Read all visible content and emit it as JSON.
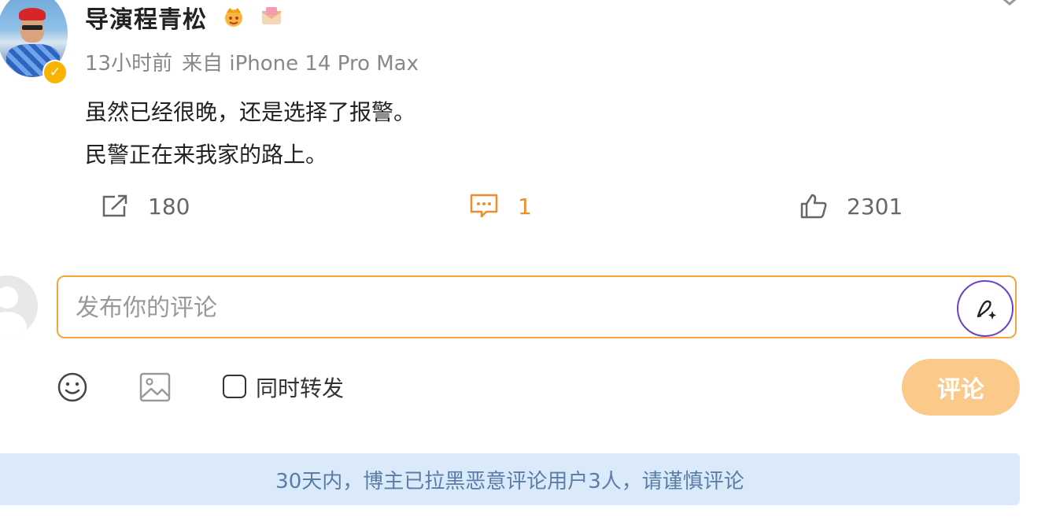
{
  "post": {
    "username": "导演程青松",
    "time": "13小时前",
    "source": "来自 iPhone 14 Pro Max",
    "lines": [
      "虽然已经很晚，还是选择了报警。",
      "民警正在来我家的路上。"
    ]
  },
  "actions": {
    "share_count": "180",
    "comment_count": "1",
    "like_count": "2301"
  },
  "comment_form": {
    "placeholder": "发布你的评论",
    "repost_label": "同时转发",
    "submit_label": "评论"
  },
  "notice": {
    "text": "30天内，博主已拉黑恶意评论用户3人，请谨慎评论"
  },
  "colors": {
    "accent": "#f5a53b",
    "comment_active": "#ee8e2a",
    "submit_disabled": "#fbc98a",
    "notice_bg": "#dbeafb",
    "notice_text": "#5a7da8",
    "verified": "#f8b400",
    "ai_ring": "#6d3fc6"
  },
  "icons": {
    "share": "share-icon",
    "comment": "comment-icon",
    "like": "thumbs-up-icon",
    "emoji": "smiley-icon",
    "image": "image-icon",
    "ai": "ai-pen-icon",
    "verified": "verified-badge-icon"
  }
}
